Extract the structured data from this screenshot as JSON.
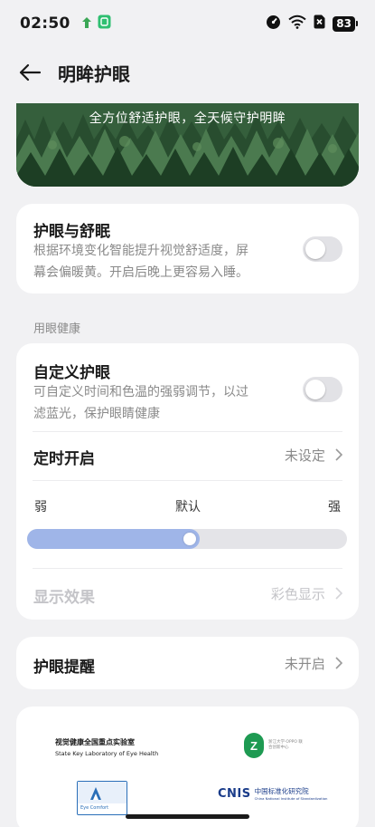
{
  "status_bar": {
    "time": "02:50",
    "battery": "83",
    "icons": [
      "upload-icon",
      "app-badge-icon",
      "data-saver-icon",
      "wifi-icon",
      "sim-off-icon",
      "battery-icon"
    ]
  },
  "nav": {
    "title": "明眸护眼"
  },
  "banner": {
    "text": "全方位舒适护眼，全天候守护明眸"
  },
  "eye_sleep": {
    "title": "护眼与舒眠",
    "desc_line1": "根据环境变化智能提升视觉舒适度，屏",
    "desc_line2": "幕会偏暖黄。开启后晚上更容易入睡。",
    "enabled": false
  },
  "section_label": "用眼健康",
  "custom": {
    "title": "自定义护眼",
    "desc_line1": "可自定义时间和色温的强弱调节，以过",
    "desc_line2": "滤蓝光，保护眼睛健康",
    "enabled": false,
    "timer_label": "定时开启",
    "timer_value": "未设定",
    "slider_min": "弱",
    "slider_mid": "默认",
    "slider_max": "强",
    "slider_level": 0.5,
    "display_label": "显示效果",
    "display_value": "彩色显示"
  },
  "reminder": {
    "label": "护眼提醒",
    "value": "未开启"
  },
  "certs": {
    "lab_cn": "视觉健康全国重点实验室",
    "lab_en": "State Key Laboratory of Eye Health",
    "zju_text": "浙江大学·OPPO 联合创新中心",
    "tuv_text": "Eye Comfort",
    "cnis_cn": "中国标准化研究院",
    "cnis_en": "China National Institute of Standardization",
    "cnis_logo": "CNIS"
  },
  "colors": {
    "accent": "#9fb5e8",
    "background": "#f1f1f3",
    "card": "#ffffff",
    "secondary_text": "#8a8a8a"
  }
}
